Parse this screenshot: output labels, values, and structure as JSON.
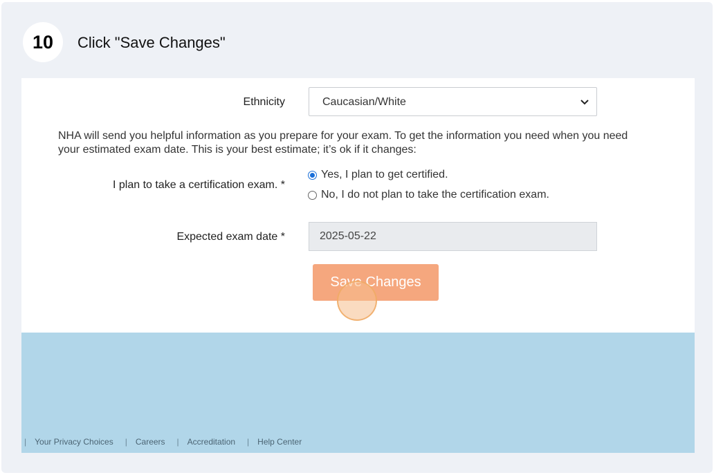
{
  "step": {
    "number": "10",
    "instruction": "Click \"Save Changes\""
  },
  "form": {
    "ethnicity_label": "Ethnicity",
    "ethnicity_value": "Caucasian/White",
    "info_line1": "NHA will send you helpful information as you prepare for your exam. To get the information you need when you need",
    "info_line2": "your estimated exam date. This is your best estimate; it’s ok if it changes:",
    "plan_label": "I plan to take a certification exam. *",
    "plan_options": [
      {
        "label": "Yes, I plan to get certified.",
        "checked": true
      },
      {
        "label": "No, I do not plan to take the certification exam.",
        "checked": false
      }
    ],
    "exam_date_label": "Expected exam date *",
    "exam_date_value": "2025-05-22",
    "save_label": "Save Changes"
  },
  "footer": {
    "separator": "|",
    "links": [
      "Your Privacy Choices",
      "Careers",
      "Accreditation",
      "Help Center"
    ]
  },
  "colors": {
    "save_button": "#f5a77e",
    "footer_bg": "#b1d6e9",
    "radio_accent": "#1a6fd8"
  }
}
